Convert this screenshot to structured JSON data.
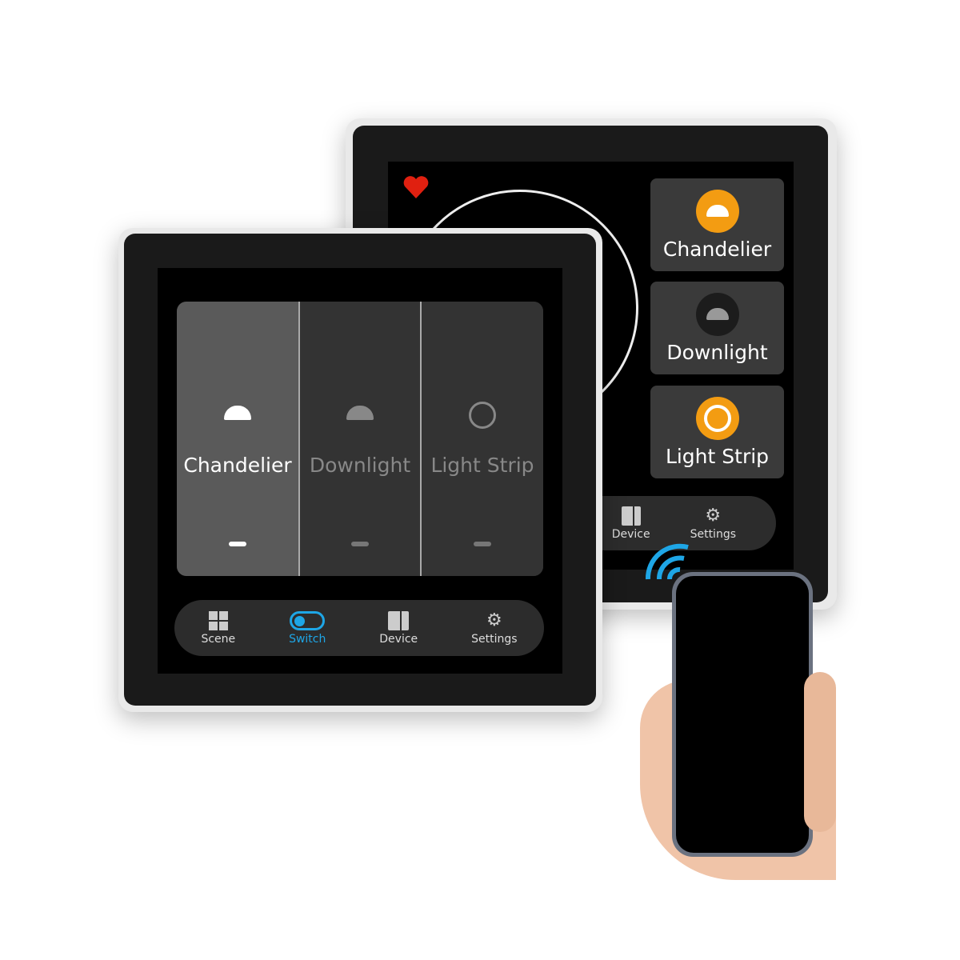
{
  "back_panel": {
    "cards": [
      {
        "label": "Chandelier",
        "icon": "chandelier-icon",
        "state": "on"
      },
      {
        "label": "Downlight",
        "icon": "downlight-icon",
        "state": "off"
      },
      {
        "label": "Light Strip",
        "icon": "light-strip-icon",
        "state": "on"
      }
    ],
    "nav": [
      {
        "label": "Device",
        "icon": "device-icon"
      },
      {
        "label": "Settings",
        "icon": "gear-icon"
      }
    ],
    "favorite_icon": "heart-icon"
  },
  "front_panel": {
    "switches": [
      {
        "label": "Chandelier",
        "icon": "chandelier-icon",
        "state": "on"
      },
      {
        "label": "Downlight",
        "icon": "downlight-icon",
        "state": "off"
      },
      {
        "label": "Light Strip",
        "icon": "light-strip-icon",
        "state": "off"
      }
    ],
    "nav": [
      {
        "label": "Scene",
        "icon": "grid-icon"
      },
      {
        "label": "Switch",
        "icon": "toggle-icon",
        "active": true
      },
      {
        "label": "Device",
        "icon": "device-icon"
      },
      {
        "label": "Settings",
        "icon": "gear-icon"
      }
    ]
  },
  "colors": {
    "accent": "#f39c12",
    "active_nav": "#1ea6e6",
    "heart": "#e02010"
  }
}
